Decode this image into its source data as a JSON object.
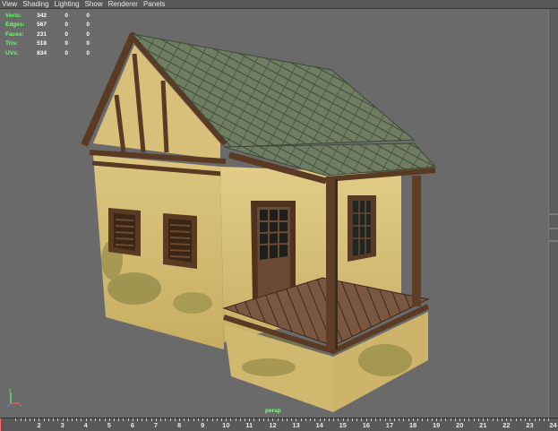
{
  "menu": [
    "View",
    "Shading",
    "Lighting",
    "Show",
    "Renderer",
    "Panels"
  ],
  "hud": [
    {
      "label": "Verts:",
      "a": "342",
      "b": "0",
      "c": "0"
    },
    {
      "label": "Edges:",
      "a": "567",
      "b": "0",
      "c": "0"
    },
    {
      "label": "Faces:",
      "a": "231",
      "b": "0",
      "c": "0"
    },
    {
      "label": "Tris:",
      "a": "518",
      "b": "0",
      "c": "0"
    },
    {
      "label": "UVs:",
      "a": "834",
      "b": "0",
      "c": "0"
    }
  ],
  "viewport": {
    "camera_label": "persp"
  },
  "axis": {
    "x": "x",
    "y": "y",
    "z": "z"
  },
  "timeline": {
    "labels": [
      "2",
      "3",
      "4",
      "5",
      "6",
      "7",
      "8",
      "9",
      "10",
      "11",
      "12",
      "13",
      "14",
      "15",
      "16",
      "17",
      "18",
      "19",
      "20",
      "21",
      "22",
      "23",
      "24"
    ],
    "current_frame": 1
  },
  "colors": {
    "viewport_bg": "#6a6a6a",
    "wall": "#d8c178",
    "roof": "#5f6d52",
    "timber": "#5a3a22",
    "hud_label": "#66ff66"
  }
}
